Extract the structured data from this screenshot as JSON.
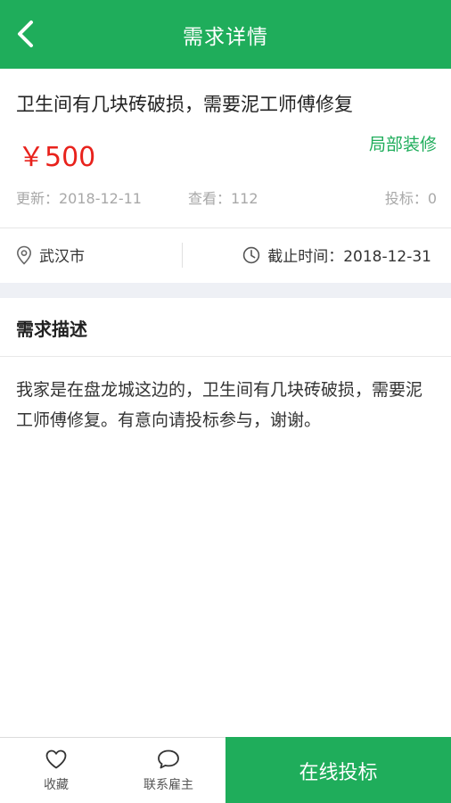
{
  "header": {
    "title": "需求详情",
    "back_icon": "chevron-left-icon"
  },
  "job": {
    "title": "卫生间有几块砖破损，需要泥工师傅修复",
    "price": "￥500",
    "category": "局部装修",
    "updated": "更新：2018-12-11",
    "views": "查看：112",
    "bids": "投标：0"
  },
  "info": {
    "city": "武汉市",
    "deadline": "截止时间：2018-12-31",
    "location_icon": "location-pin-icon",
    "deadline_icon": "clock-icon"
  },
  "description": {
    "section_title": "需求描述",
    "text": "我家是在盘龙城这边的，卫生间有几块砖破损，需要泥工师傅修复。有意向请投标参与，谢谢。"
  },
  "bottom_bar": {
    "favorite_label": "收藏",
    "contact_label": "联系雇主",
    "bid_label": "在线投标",
    "favorite_icon": "heart-icon",
    "contact_icon": "chat-bubble-icon"
  },
  "colors": {
    "brand_green": "#1fad5b",
    "price_red": "#e8221c",
    "meta_gray": "#a8a8a8",
    "band_gray": "#eef0f5"
  }
}
